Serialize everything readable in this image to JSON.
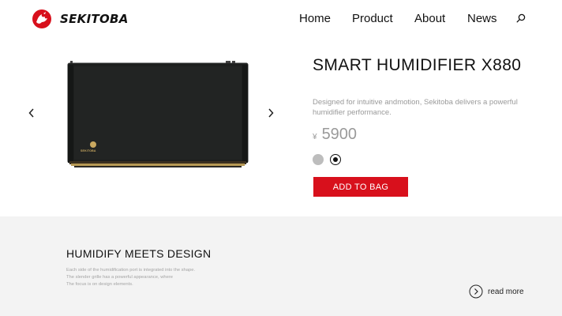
{
  "brand": {
    "name": "SEKITOBA",
    "accent_color": "#d8101c"
  },
  "nav": {
    "items": [
      {
        "label": "Home"
      },
      {
        "label": "Product"
      },
      {
        "label": "About"
      },
      {
        "label": "News"
      }
    ],
    "search_icon": "search-icon"
  },
  "carousel": {
    "prev_icon": "chevron-left-icon",
    "next_icon": "chevron-right-icon"
  },
  "product": {
    "title": "SMART HUMIDIFIER X880",
    "description": "Designed for intuitive andmotion, Sekitoba delivers a powerful humidifier performance.",
    "price_currency": "¥",
    "price_value": "5900",
    "image_logo_text": "SEKITOBA",
    "swatches": [
      {
        "color": "#bdbdbd",
        "selected": false
      },
      {
        "color": "#111111",
        "selected": true
      }
    ],
    "add_to_bag_label": "ADD TO BAG"
  },
  "design_section": {
    "title": "HUMIDIFY MEETS DESIGN",
    "lines": [
      "Each side of the humidification port is integrated into the shape.",
      "The slender grille has a powerful appearance, where",
      "The focus is on design elements."
    ],
    "read_more_label": "read more",
    "background": "#f3f3f3"
  }
}
